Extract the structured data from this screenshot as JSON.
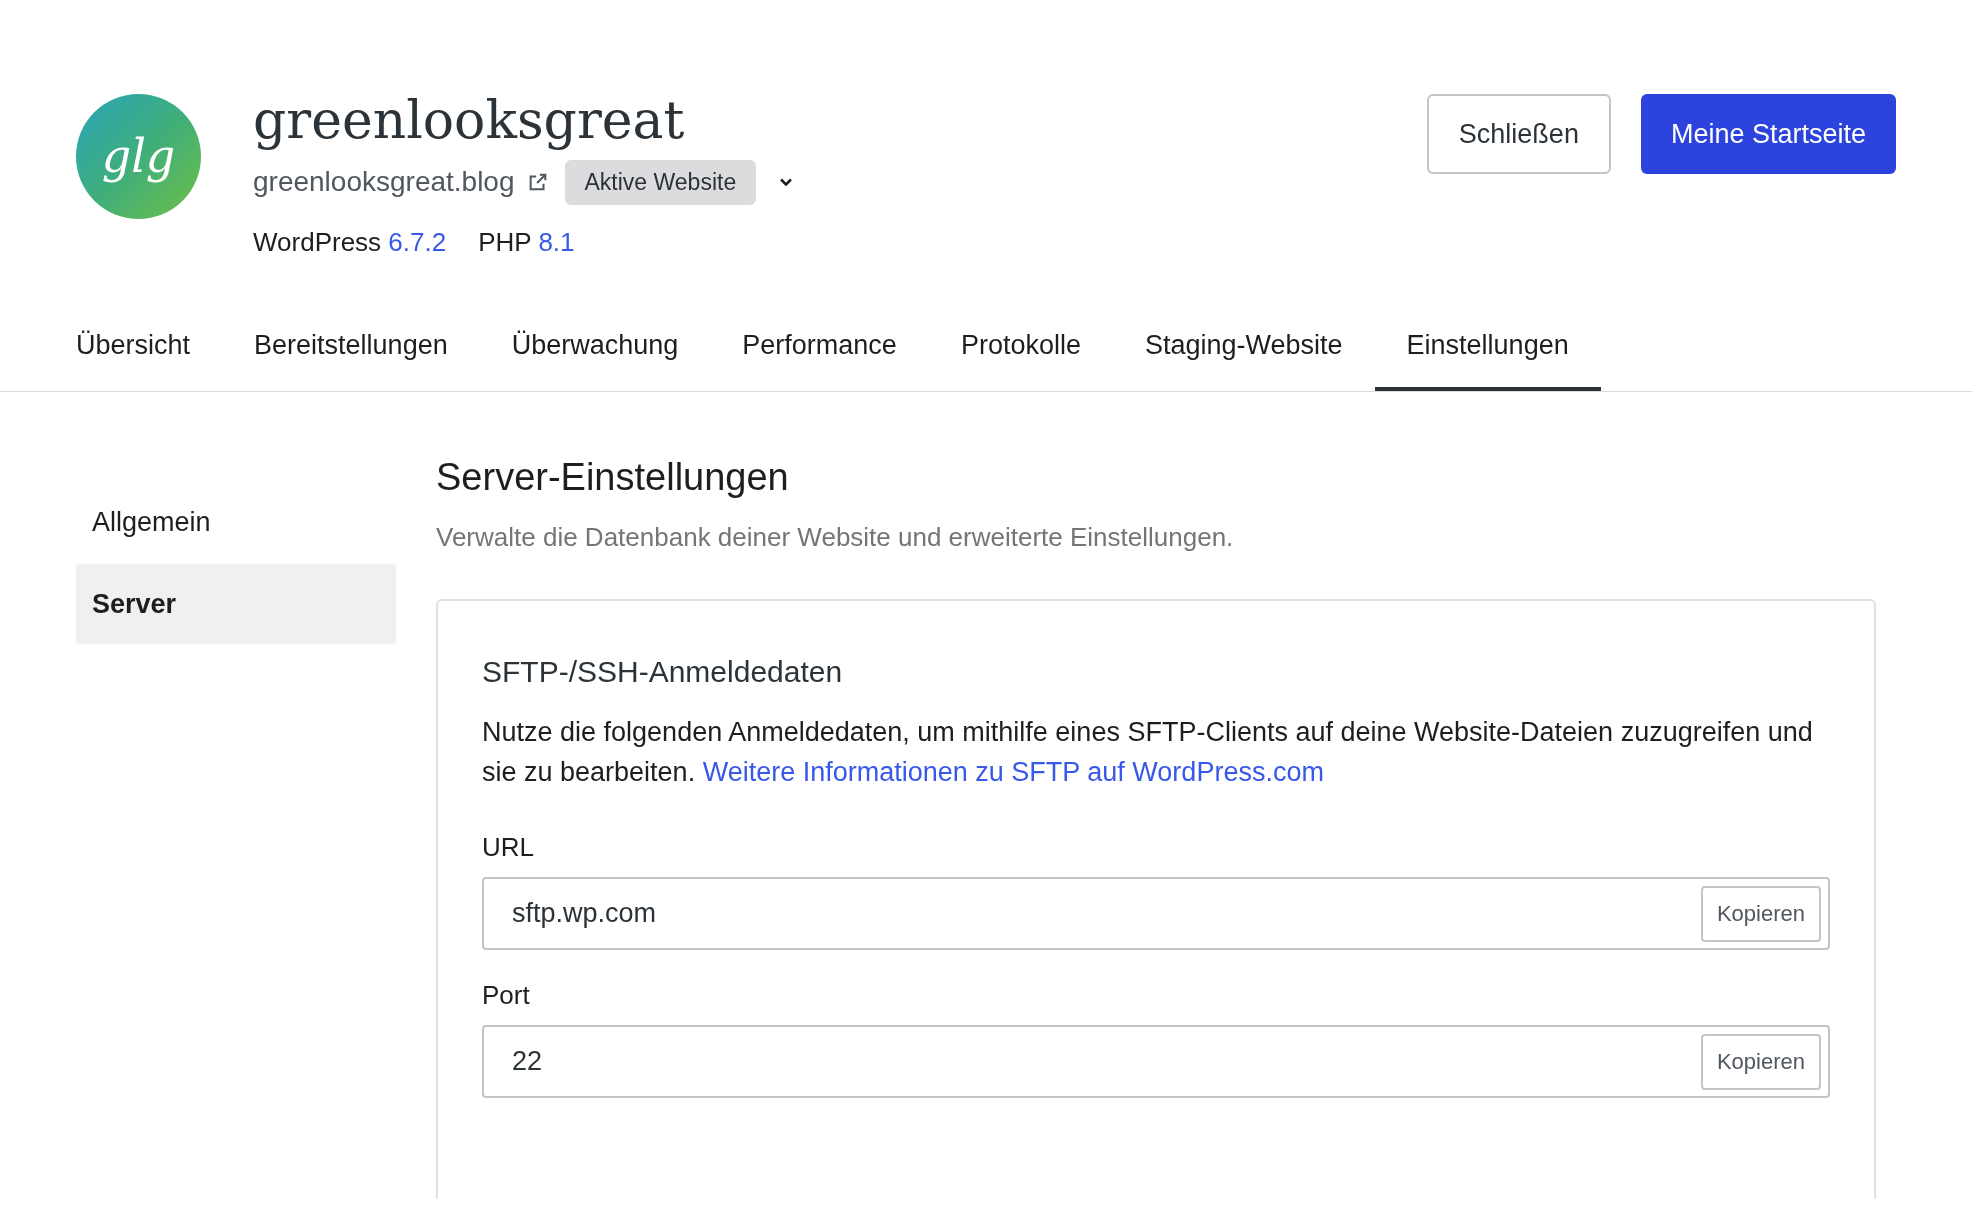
{
  "site": {
    "title": "greenlooksgreat",
    "logo_text": "glg",
    "url": "greenlooksgreat.blog",
    "status_badge": "Aktive Website",
    "versions": [
      {
        "label": "WordPress",
        "value": "6.7.2"
      },
      {
        "label": "PHP",
        "value": "8.1"
      }
    ]
  },
  "actions": [
    {
      "label": "Schließen",
      "kind": "secondary"
    },
    {
      "label": "Meine Startseite",
      "kind": "primary"
    }
  ],
  "tabs": [
    {
      "label": "Übersicht",
      "selected": false
    },
    {
      "label": "Bereitstellungen",
      "selected": false
    },
    {
      "label": "Überwachung",
      "selected": false
    },
    {
      "label": "Performance",
      "selected": false
    },
    {
      "label": "Protokolle",
      "selected": false
    },
    {
      "label": "Staging-Website",
      "selected": false
    },
    {
      "label": "Einstellungen",
      "selected": true
    }
  ],
  "sidebar": {
    "items": [
      {
        "label": "Allgemein",
        "selected": false
      },
      {
        "label": "Server",
        "selected": true
      }
    ]
  },
  "page": {
    "title": "Server-Einstellungen",
    "subtitle": "Verwalte die Datenbank deiner Website und erweiterte Einstellungen."
  },
  "card": {
    "title": "SFTP-/SSH-Anmeldedaten",
    "description": "Nutze die folgenden Anmeldedaten, um mithilfe eines SFTP-Clients auf deine Website-Dateien zuzugreifen und sie zu bearbeiten.",
    "link": "Weitere Informationen zu SFTP auf WordPress.com",
    "fields": [
      {
        "label": "URL",
        "value": "sftp.wp.com",
        "button": "Kopieren"
      },
      {
        "label": "Port",
        "value": "22",
        "button": "Kopieren"
      }
    ]
  }
}
